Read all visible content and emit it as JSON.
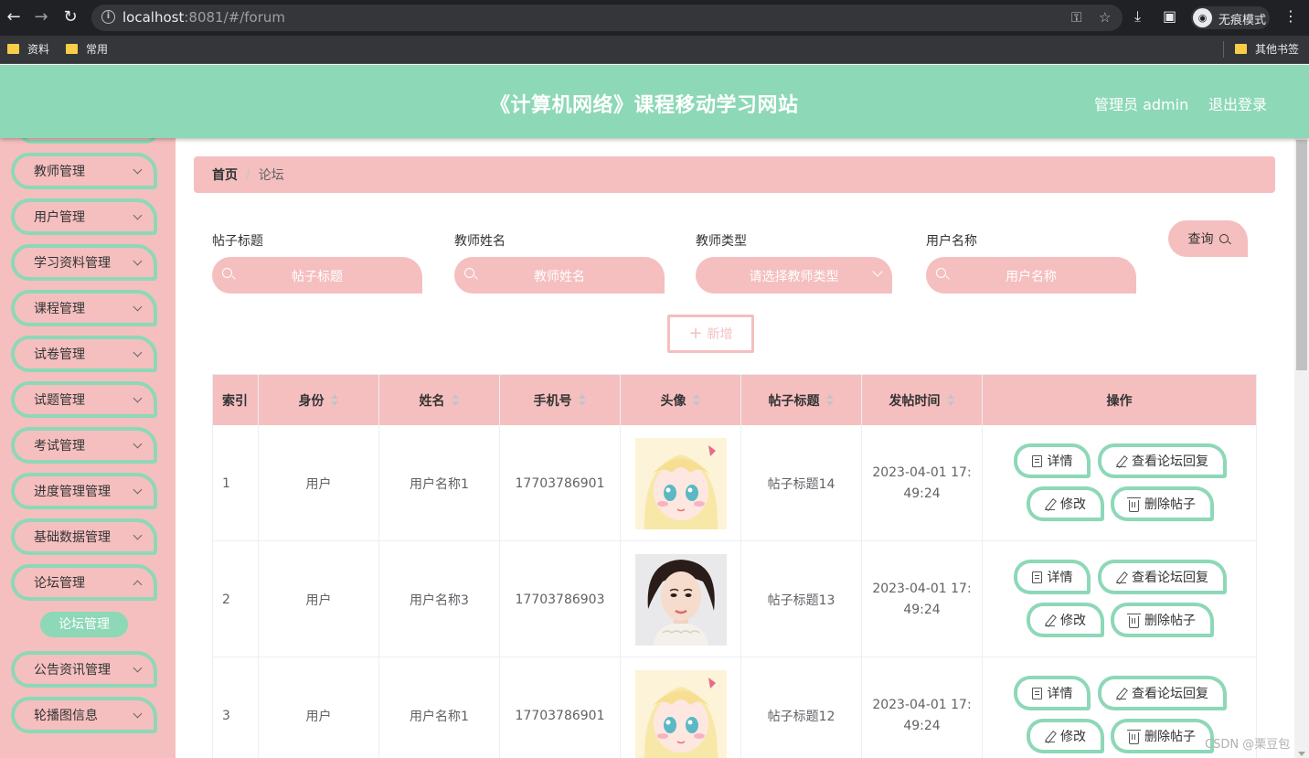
{
  "browser": {
    "url_host": "localhost",
    "url_rest": ":8081/#/forum",
    "incognito_label": "无痕模式",
    "bookmarks": [
      "资料",
      "常用"
    ],
    "other_bookmarks": "其他书签"
  },
  "header": {
    "title": "《计算机网络》课程移动学习网站",
    "admin": "管理员 admin",
    "logout": "退出登录"
  },
  "sidebar": {
    "items": [
      {
        "label": "教师管理"
      },
      {
        "label": "用户管理"
      },
      {
        "label": "学习资料管理"
      },
      {
        "label": "课程管理"
      },
      {
        "label": "试卷管理"
      },
      {
        "label": "试题管理"
      },
      {
        "label": "考试管理"
      },
      {
        "label": "进度管理管理"
      },
      {
        "label": "基础数据管理"
      },
      {
        "label": "论坛管理"
      },
      {
        "label": "公告资讯管理"
      },
      {
        "label": "轮播图信息"
      }
    ],
    "active_sub": "论坛管理"
  },
  "breadcrumb": {
    "home": "首页",
    "separator": "/",
    "current": "论坛"
  },
  "filters": {
    "post_title": {
      "label": "帖子标题",
      "placeholder": "帖子标题"
    },
    "teacher_name": {
      "label": "教师姓名",
      "placeholder": "教师姓名"
    },
    "teacher_type": {
      "label": "教师类型",
      "placeholder": "请选择教师类型"
    },
    "user_name": {
      "label": "用户名称",
      "placeholder": "用户名称"
    },
    "query_label": "查询"
  },
  "add_label": "新增",
  "table": {
    "headers": [
      "索引",
      "身份",
      "姓名",
      "手机号",
      "头像",
      "帖子标题",
      "发帖时间",
      "操作"
    ],
    "rows": [
      {
        "index": "1",
        "role": "用户",
        "name": "用户名称1",
        "phone": "17703786901",
        "avatar": "anime-girl-avatar",
        "title": "帖子标题14",
        "time": "2023-04-01 17:49:24"
      },
      {
        "index": "2",
        "role": "用户",
        "name": "用户名称3",
        "phone": "17703786903",
        "avatar": "woman-portrait-avatar",
        "title": "帖子标题13",
        "time": "2023-04-01 17:49:24"
      },
      {
        "index": "3",
        "role": "用户",
        "name": "用户名称1",
        "phone": "17703786901",
        "avatar": "anime-girl-avatar",
        "title": "帖子标题12",
        "time": "2023-04-01 17:49:24"
      }
    ],
    "actions": {
      "detail": "详情",
      "view_replies": "查看论坛回复",
      "edit": "修改",
      "delete": "删除帖子"
    }
  },
  "watermark": "CSDN @栗豆包",
  "colors": {
    "header": "#8dd8b7",
    "accent_pink": "#f5bfbf",
    "chrome_dark": "#202124"
  }
}
